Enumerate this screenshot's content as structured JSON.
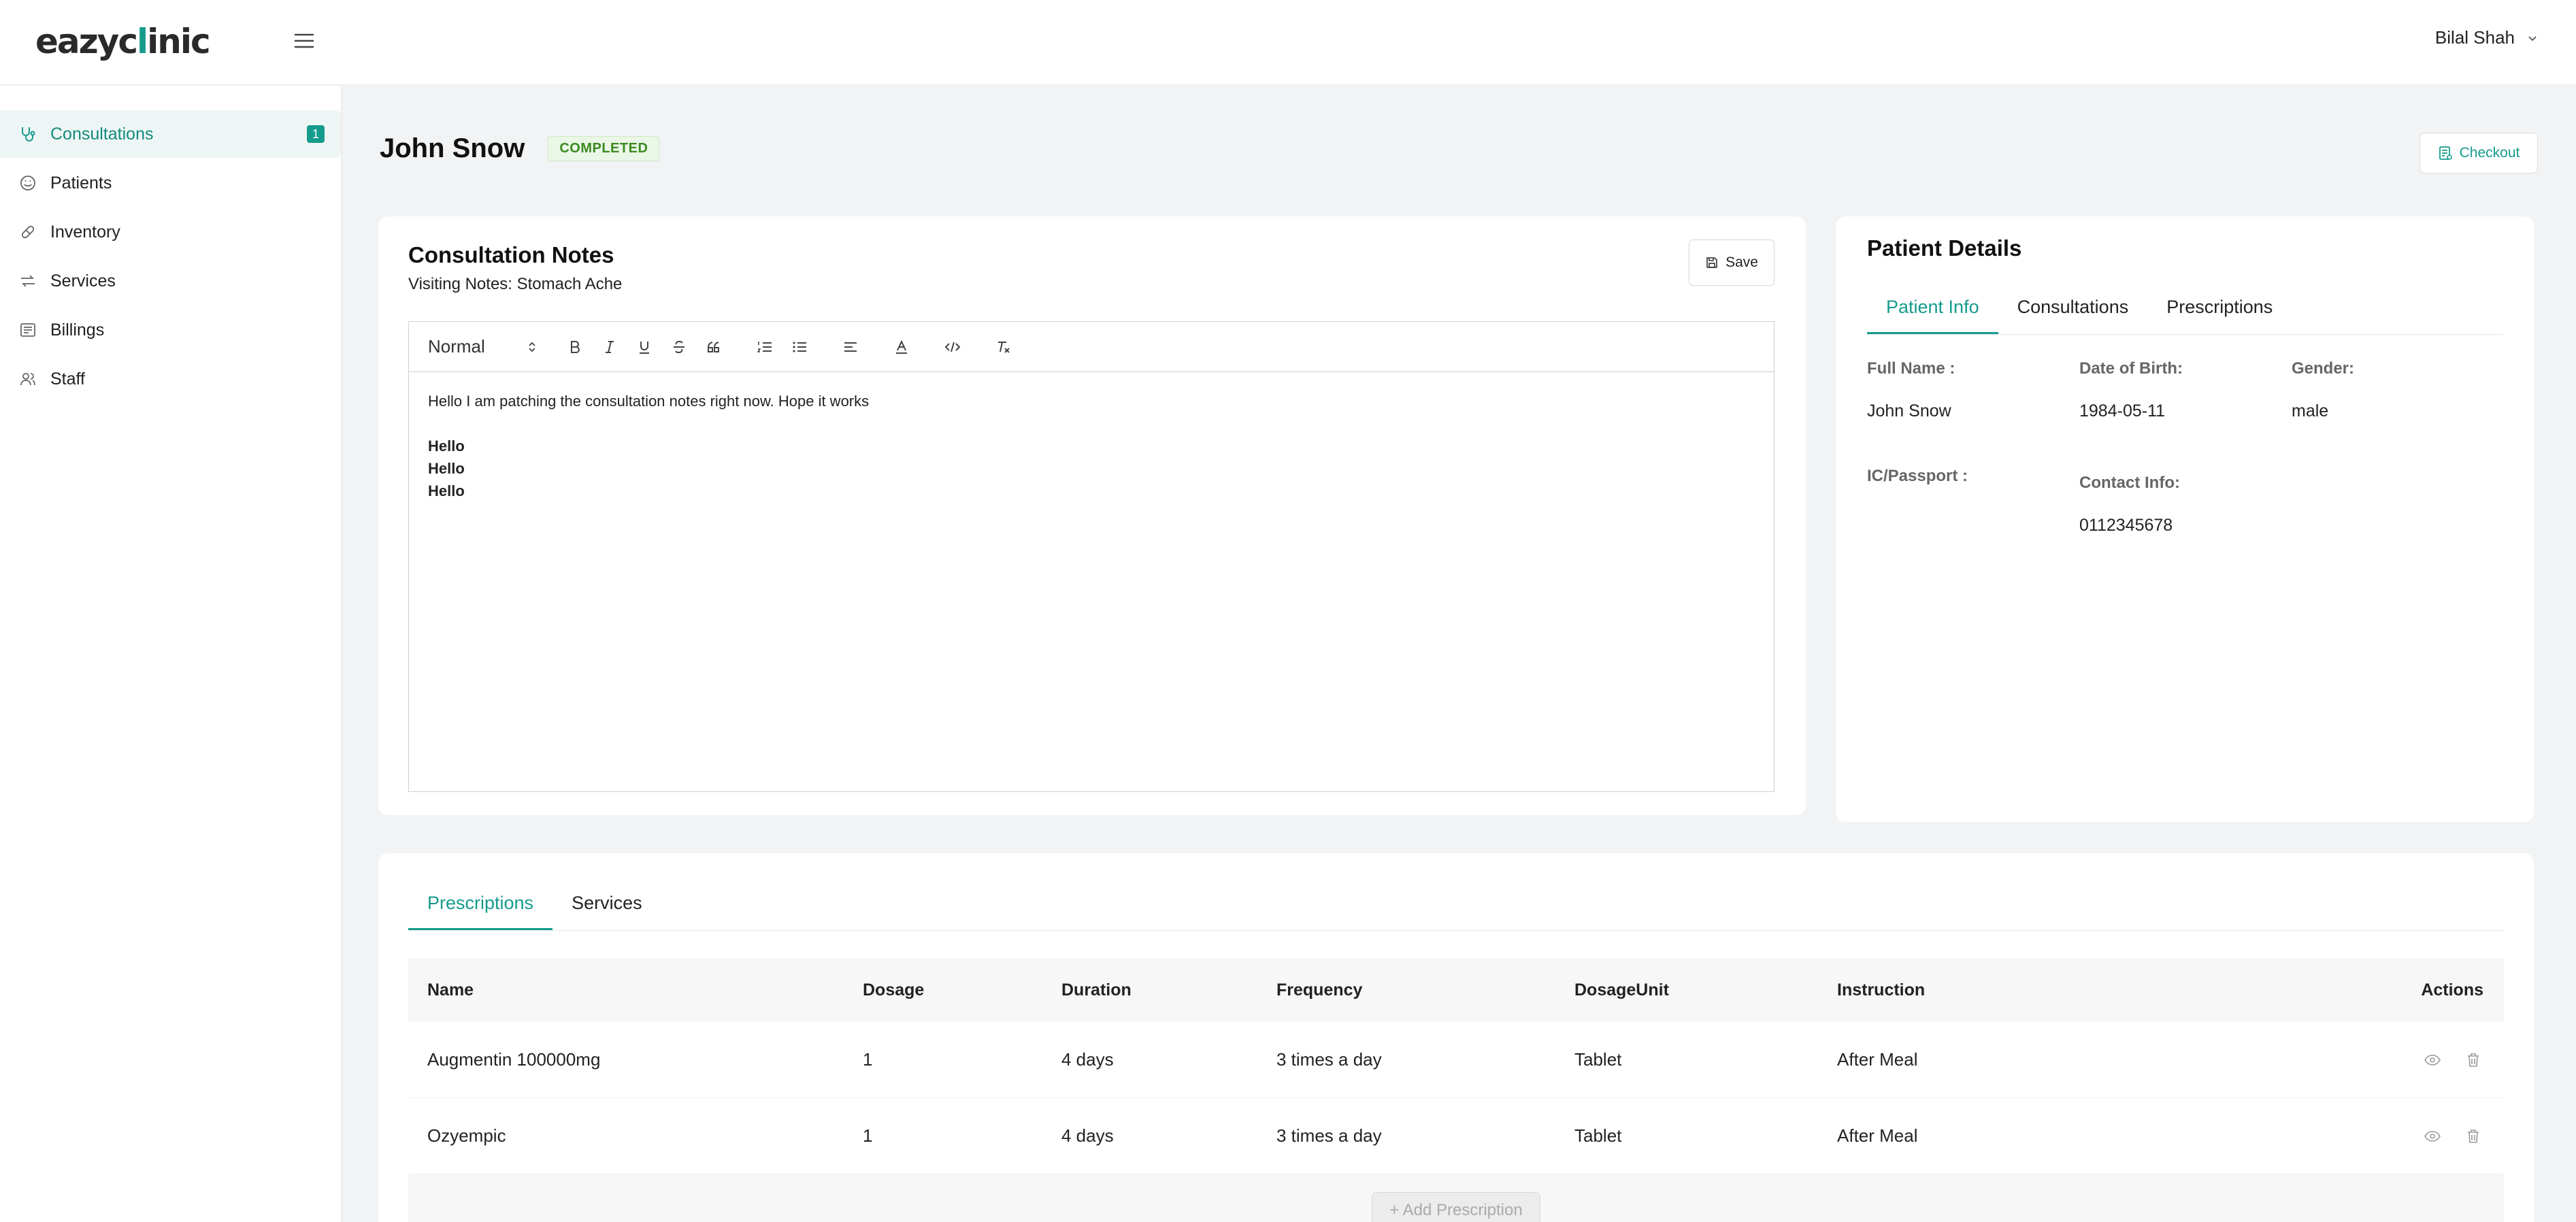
{
  "app": {
    "logo_pre": "eazyc",
    "logo_x": "l",
    "logo_post": "inic"
  },
  "header": {
    "user_name": "Bilal Shah"
  },
  "sidebar": {
    "items": [
      {
        "label": "Consultations",
        "badge": "1"
      },
      {
        "label": "Patients"
      },
      {
        "label": "Inventory"
      },
      {
        "label": "Services"
      },
      {
        "label": "Billings"
      },
      {
        "label": "Staff"
      }
    ]
  },
  "page": {
    "title": "John Snow",
    "status": "COMPLETED",
    "checkout_label": "Checkout"
  },
  "notes": {
    "title": "Consultation Notes",
    "subtitle": "Visiting Notes: Stomach Ache",
    "save_label": "Save",
    "format_select": "Normal",
    "body": {
      "line1": "Hello I am patching the consultation notes right now. Hope it works",
      "bold_lines": [
        "Hello",
        "Hello",
        "Hello"
      ]
    }
  },
  "patient": {
    "title": "Patient Details",
    "tabs": [
      "Patient Info",
      "Consultations",
      "Prescriptions"
    ],
    "fields": {
      "full_name_label": "Full Name :",
      "full_name": "John Snow",
      "dob_label": "Date of Birth:",
      "dob": "1984-05-11",
      "gender_label": "Gender:",
      "gender": "male",
      "ic_label": "IC/Passport :",
      "contact_label": "Contact Info:",
      "contact": "0112345678"
    }
  },
  "bottom": {
    "tabs": [
      "Prescriptions",
      "Services"
    ],
    "columns": [
      "Name",
      "Dosage",
      "Duration",
      "Frequency",
      "DosageUnit",
      "Instruction",
      "Actions"
    ],
    "rows": [
      [
        "Augmentin 100000mg",
        "1",
        "4 days",
        "3 times a day",
        "Tablet",
        "After Meal"
      ],
      [
        "Ozyempic",
        "1",
        "4 days",
        "3 times a day",
        "Tablet",
        "After Meal"
      ]
    ],
    "add_label": "+ Add Prescription"
  },
  "colors": {
    "accent": "#159b8c",
    "status_green": "#3a8a20"
  }
}
